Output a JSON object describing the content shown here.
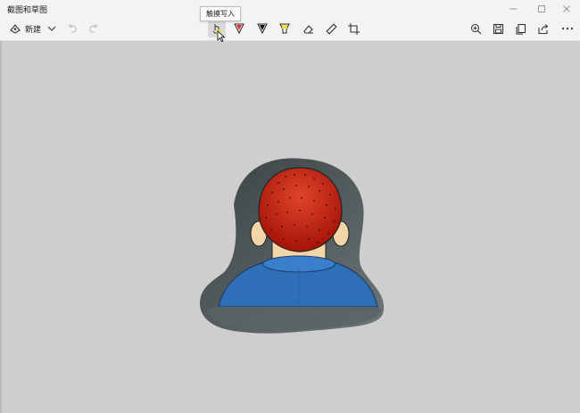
{
  "app": {
    "title": "截图和草图"
  },
  "toolbar": {
    "new_label": "新建",
    "tooltip": "触摸写入"
  },
  "colors": {
    "accent": "#0a78d4",
    "ballpoint": "#e0332e",
    "pencil": "#111111",
    "highlighter": "#f2e03a",
    "hair_red": "#c2200e",
    "shirt_blue": "#2f6fb8"
  },
  "icons": {
    "new": "snip-new-icon",
    "dropdown": "chevron-down-icon",
    "undo": "undo-icon",
    "redo": "redo-icon",
    "touch": "touch-writing-icon",
    "ballpoint": "ballpoint-pen-icon",
    "pencil": "pencil-icon",
    "highlighter": "highlighter-icon",
    "eraser": "eraser-icon",
    "ruler": "ruler-icon",
    "crop": "crop-icon",
    "zoom": "zoom-in-icon",
    "save": "save-icon",
    "copy": "copy-icon",
    "share": "share-icon",
    "more": "more-icon"
  }
}
